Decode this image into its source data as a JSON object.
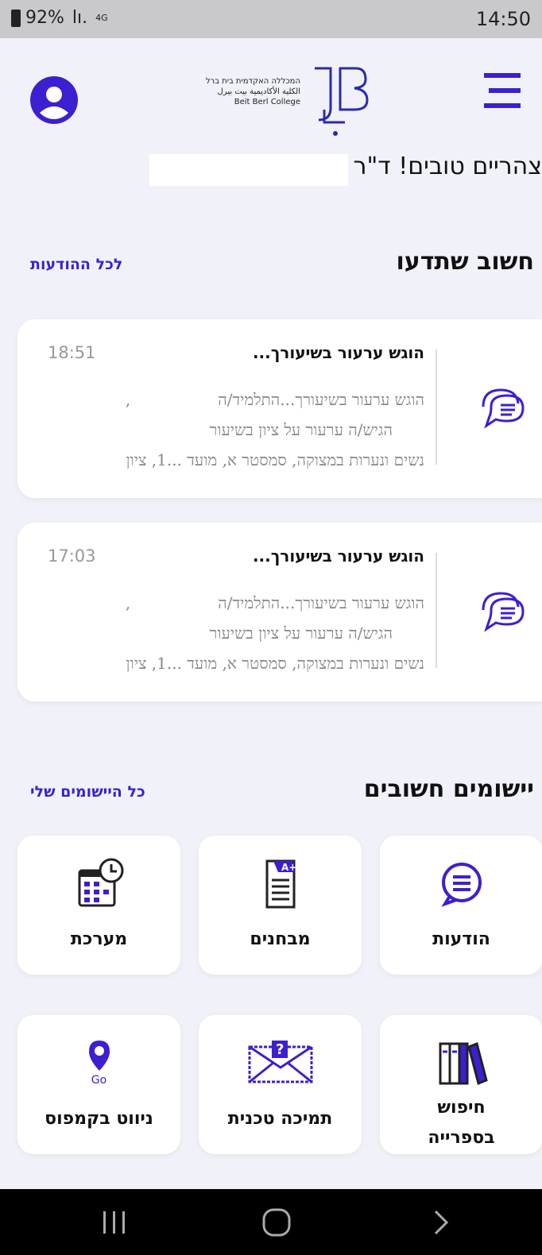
{
  "status": {
    "battery": "92%",
    "signal": "lı.",
    "network": "4G",
    "time": "14:50"
  },
  "header": {
    "logo_lines": [
      "המכללה האקדמית בית ברל",
      "الكلية الأكاديمية بيت بيرل",
      "Beit Berl College"
    ],
    "profile_icon": "user-icon",
    "menu_icon": "menu-icon"
  },
  "greeting": "צהריים טובים! ד\"ר",
  "notices": {
    "title": "חשוב שתדעו",
    "link": "לכל ההודעות",
    "items": [
      {
        "time": "18:51",
        "title": "הוגש ערעור בשיעורך...",
        "line1": "הוגש ערעור בשיעורך...התלמיד/ה",
        "line1b": ",",
        "line2": "הגיש/ה ערעור על ציון בשיעור",
        "line3": "נשים ונערות במצוקה, סמסטר א, מועד ...1, ציון"
      },
      {
        "time": "17:03",
        "title": "הוגש ערעור בשיעורך...",
        "line1": "הוגש ערעור בשיעורך...התלמיד/ה",
        "line1b": ",",
        "line2": "הגיש/ה ערעור על ציון בשיעור",
        "line3": "נשים ונערות במצוקה, סמסטר א, מועד ...1, ציון"
      }
    ]
  },
  "apps": {
    "title": "יישומים חשובים",
    "link": "כל היישומים שלי",
    "tiles": [
      {
        "label": "הודעות",
        "icon": "chat-bubble-icon"
      },
      {
        "label": "מבחנים",
        "icon": "exam-grade-icon"
      },
      {
        "label": "מערכת",
        "icon": "timetable-icon"
      },
      {
        "label1": "חיפוש",
        "label2": "בספרייה",
        "icon": "library-books-icon"
      },
      {
        "label": "תמיכה טכנית",
        "icon": "support-envelope-icon"
      },
      {
        "label": "ניווט בקמפוס",
        "icon": "campus-map-pin-icon",
        "badge": "Go"
      }
    ]
  },
  "colors": {
    "accent": "#3c1fd0",
    "background": "#f1f2f9",
    "card": "#ffffff"
  }
}
